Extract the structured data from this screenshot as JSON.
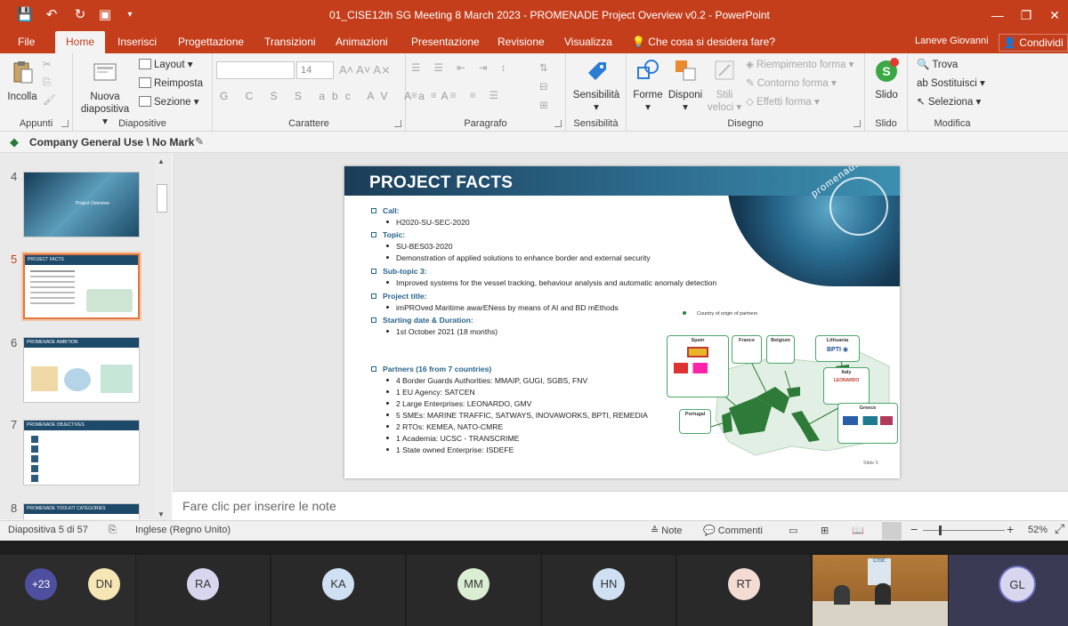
{
  "window": {
    "title": "01_CISE12th SG Meeting 8 March 2023 - PROMENADE Project Overview v0.2 - PowerPoint",
    "controls": [
      "—",
      "❐",
      "✕"
    ]
  },
  "tabs": [
    "File",
    "Home",
    "Inserisci",
    "Progettazione",
    "Transizioni",
    "Animazioni",
    "Presentazione",
    "Revisione",
    "Visualizza"
  ],
  "tell_me": "Che cosa si desidera fare?",
  "user_name": "Laneve Giovanni",
  "share_label": "Condividi",
  "ribbon": {
    "groups": [
      "Appunti",
      "Diapositive",
      "Carattere",
      "Paragrafo",
      "Sensibilità",
      "Disegno",
      "Slido",
      "Modifica"
    ],
    "paste": "Incolla",
    "new_slide": [
      "Nuova",
      "diapositiva"
    ],
    "layout": "Layout",
    "reset": "Reimposta",
    "section": "Sezione",
    "font_size": "14",
    "format_buttons": "G C S S abc AV Aa A",
    "sensitivity": "Sensibilità",
    "shapes": "Forme",
    "arrange": "Disponi",
    "styles": [
      "Stili",
      "veloci"
    ],
    "shape_fill": "Riempimento forma",
    "shape_outline": "Contorno forma",
    "shape_effects": "Effetti forma",
    "slido": "Slido",
    "find": "Trova",
    "replace": "Sostituisci",
    "select": "Seleziona"
  },
  "sensitivity_label": "Company General Use \\ No Mark",
  "thumbnails": [
    {
      "num": "4",
      "caption": "Project Overview"
    },
    {
      "num": "5",
      "caption": "PROJECT FACTS"
    },
    {
      "num": "6",
      "caption": "PROMENADE AMBITION"
    },
    {
      "num": "7",
      "caption": "PROMENADE OBJECTIVES"
    },
    {
      "num": "8",
      "caption": "PROMENADE TOOLKIT CATEGORIES"
    }
  ],
  "slide": {
    "title": "PROJECT FACTS",
    "logo_text": "promenade",
    "call_h": "Call:",
    "call": "H2020-SU-SEC-2020",
    "topic_h": "Topic:",
    "topic_1": "SU-BES03-2020",
    "topic_2": "Demonstration of applied solutions to enhance border and external security",
    "subtopic_h": "Sub-topic 3:",
    "subtopic": "Improved systems for the vessel tracking, behaviour analysis and automatic anomaly detection",
    "ptitle_h": "Project title:",
    "ptitle": "imPROved Maritime awarENess by means of AI and BD mEthods",
    "start_h": "Starting date & Duration:",
    "start": "1st October 2021 (18 months)",
    "partners_h": "Partners (16 from 7 countries)",
    "partners": [
      "4 Border Guards Authorities: MMAIP, GUGI, SGBS, FNV",
      "1 EU Agency: SATCEN",
      "2 Large Enterprises: LEONARDO, GMV",
      "5 SMEs: MARINE TRAFFIC, SATWAYS, INOVAWORKS, BPTI, REMEDIA",
      "2 RTOs: KEMEA, NATO-CMRE",
      "1 Academia: UCSC - TRANSCRIME",
      "1 State owned Enterprise: ISDEFE"
    ],
    "legend": "Country of origin of partners",
    "countries": [
      "Spain",
      "France",
      "Belgium",
      "Lithuania",
      "Italy",
      "Portugal",
      "Greece"
    ],
    "slide_number": "Slide 5"
  },
  "notes_placeholder": "Fare clic per inserire le note",
  "status": {
    "slide_of": "Diapositiva 5 di 57",
    "language": "Inglese (Regno Unito)",
    "notes": "Note",
    "comments": "Commenti",
    "zoom": "52%"
  },
  "meeting": {
    "overflow": "+23",
    "participants": [
      "DN",
      "RA",
      "KA",
      "MM",
      "HN",
      "RT",
      "GL"
    ],
    "video_caption": "CISE"
  },
  "colors": {
    "accent": "#c43e1c",
    "slide_head": "#1b3d58",
    "slide_heading_text": "#27628a"
  }
}
